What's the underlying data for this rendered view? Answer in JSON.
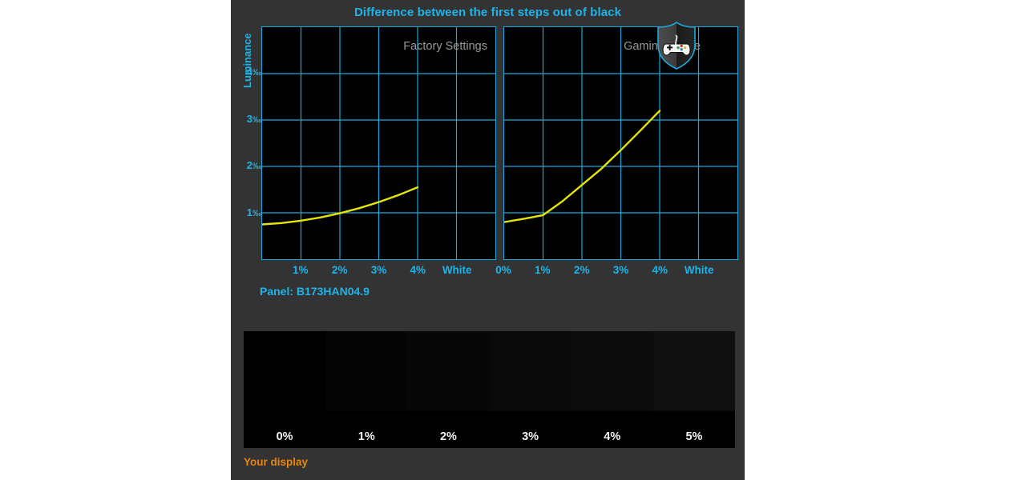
{
  "title": "Difference between the first steps out of black",
  "colors": {
    "panel_bg": "#333333",
    "accent_cyan": "#1eb4ea",
    "grid_cyan": "#1fa8dc",
    "curve_yellow": "#e6e600",
    "plot_bg": "#000000",
    "label_gray": "#9a9a9a",
    "caption_orange": "#e8860d",
    "swatch_text": "#f2f2f2"
  },
  "axis": {
    "y_title": "Luminance",
    "y_ticks": [
      "1",
      "2",
      "3",
      "4"
    ],
    "y_unit": "‰"
  },
  "panel_info": {
    "label": "Panel: B173HAN04.9"
  },
  "badge": {
    "name": "gaming-shield-badge"
  },
  "footer": {
    "caption": "Your display"
  },
  "gradient_strip": {
    "labels": [
      "0%",
      "1%",
      "2%",
      "3%",
      "4%",
      "5%"
    ],
    "swatch_colors": [
      "#000000",
      "#050505",
      "#070707",
      "#0a0a0a",
      "#0c0c0c",
      "#0f0f0f"
    ]
  },
  "chart_data": [
    {
      "type": "line",
      "title": "Factory Settings",
      "xlabel": "",
      "ylabel": "Luminance",
      "yunit": "‰",
      "grid": true,
      "legend": "none",
      "x_ticks": [
        "1%",
        "2%",
        "3%",
        "4%",
        "White"
      ],
      "x_tick_positions": [
        1,
        2,
        3,
        4,
        5
      ],
      "xlim": [
        0,
        6
      ],
      "ylim": [
        0,
        5
      ],
      "x": [
        0,
        0.5,
        1,
        1.5,
        2,
        2.5,
        3,
        3.5,
        4
      ],
      "values": [
        0.75,
        0.78,
        0.83,
        0.9,
        0.99,
        1.1,
        1.23,
        1.38,
        1.55
      ]
    },
    {
      "type": "line",
      "title": "Gaming Profile",
      "xlabel": "",
      "ylabel": "Luminance",
      "yunit": "‰",
      "grid": true,
      "legend": "none",
      "x_ticks": [
        "0%",
        "1%",
        "2%",
        "3%",
        "4%",
        "White"
      ],
      "x_tick_positions": [
        0,
        1,
        2,
        3,
        4,
        5
      ],
      "xlim": [
        0,
        6
      ],
      "ylim": [
        0,
        5
      ],
      "x": [
        0,
        0.5,
        1,
        1.5,
        2,
        2.5,
        3,
        3.5,
        4
      ],
      "values": [
        0.8,
        0.87,
        0.95,
        1.25,
        1.6,
        1.95,
        2.35,
        2.77,
        3.2
      ]
    }
  ]
}
